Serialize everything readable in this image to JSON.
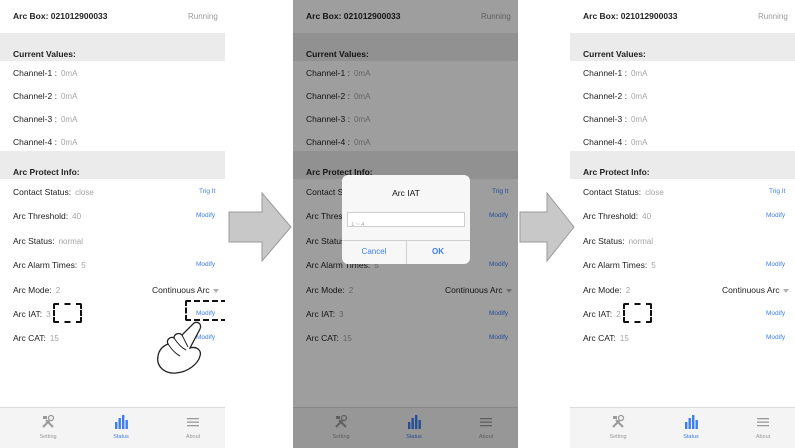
{
  "header": {
    "title": "Arc Box: 021012900033",
    "status": "Running"
  },
  "current": {
    "heading": "Current Values:",
    "channels": [
      {
        "label": "Channel-1 :",
        "value": "0mA"
      },
      {
        "label": "Channel-2 :",
        "value": "0mA"
      },
      {
        "label": "Channel-3 :",
        "value": "0mA"
      },
      {
        "label": "Channel-4 :",
        "value": "0mA"
      }
    ]
  },
  "protect": {
    "heading": "Arc Protect Info:",
    "contact_label": "Contact Status:",
    "contact_value": "close",
    "trig_label": "Trig It",
    "threshold_label": "Arc Threshold:",
    "threshold_value": "40",
    "arc_status_label": "Arc Status:",
    "arc_status_value": "normal",
    "alarm_label": "Arc Alarm Times:",
    "alarm_value": "5",
    "mode_label": "Arc Mode:",
    "mode_value": "2",
    "mode_select": "Continuous Arc",
    "iat_label": "Arc IAT:",
    "iat_value_before": "3",
    "iat_value_after": "2",
    "cat_label": "Arc CAT:",
    "cat_value": "15",
    "modify_label": "Modify"
  },
  "dialog": {
    "title": "Arc IAT",
    "placeholder": "1 ~ 4",
    "cancel": "Cancel",
    "ok": "OK"
  },
  "tabs": [
    {
      "label": "Setting",
      "icon": "tools-icon"
    },
    {
      "label": "Status",
      "icon": "bar-chart-icon"
    },
    {
      "label": "About",
      "icon": "menu-lines-icon"
    }
  ],
  "active_tab": "Status",
  "colors": {
    "accent": "#3d7ef0",
    "section_bg": "#ebebeb",
    "arrow_fill": "#c8c8c8",
    "arrow_stroke": "#9a9a9a"
  }
}
